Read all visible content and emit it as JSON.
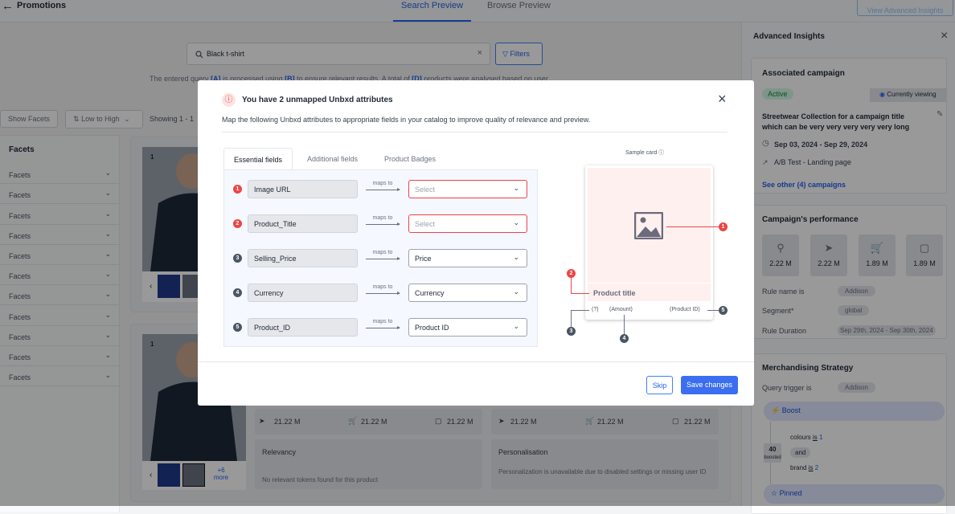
{
  "header": {
    "back_icon": "arrow-left-icon",
    "title": "Promotions",
    "tabs": [
      "Search Preview",
      "Browse Preview"
    ],
    "active_tab": "Search Preview",
    "advanced_button": "View Advanced Insights"
  },
  "search": {
    "value": "Black t-shirt",
    "filters_label": "Filters"
  },
  "info_text": {
    "prefix": "The entered query",
    "a": "[A]",
    "mid1": "is processed using",
    "b": "[B]",
    "mid2": "to ensure relevant results. A total of",
    "d": "[D]",
    "suffix": "products were analysed based on user"
  },
  "toolbar": {
    "show_facets": "Show Facets",
    "sort": "Low to High",
    "showing": "Showing 1 - 1"
  },
  "facets": {
    "title": "Facets",
    "items": [
      "Facets",
      "Facets",
      "Facets",
      "Facets",
      "Facets",
      "Facets",
      "Facets",
      "Facets",
      "Facets",
      "Facets",
      "Facets"
    ]
  },
  "products": [
    {
      "rank": "1"
    },
    {
      "rank": "1",
      "more": "+6",
      "more2": "more",
      "metrics": [
        "21.22 M",
        "21.22 M",
        "21.22 M",
        "21.22 M",
        "21.22 M",
        "21.22 M"
      ],
      "relevancy_title": "Relevancy",
      "relevancy_text": "No relevant tokens found for this product",
      "personal_title": "Personalisation",
      "personal_text": "Personalization is unavailable due to disabled settings or missing user ID"
    }
  ],
  "insights": {
    "title": "Advanced Insights",
    "associated": {
      "title": "Associated campaign",
      "status": "Active",
      "viewing": "Currently viewing",
      "name": "Streetwear Collection for a campaign title which can be very very very very very long",
      "dates": "Sep 03, 2024 - Sep 29, 2024",
      "test": "A/B Test - Landing page",
      "link": "See other (4) campaigns"
    },
    "performance": {
      "title": "Campaign's performance",
      "metrics": [
        "2.22 M",
        "2.22 M",
        "1.89 M",
        "1.89 M"
      ],
      "rule_label": "Rule name is",
      "rule": "Addison",
      "segment_label": "Segment*",
      "segment": "global",
      "duration_label": "Rule Duration",
      "duration": "Sep 29th, 2024 - Sep 30th, 2024"
    },
    "strategy": {
      "title": "Merchandising Strategy",
      "trigger_label": "Query trigger is",
      "trigger": "Addison",
      "boost": "Boost",
      "boost_count": "40",
      "boost_sub": "boosted",
      "c1": "colours",
      "is1": "is",
      "v1": "1",
      "and": "and",
      "c2": "brand",
      "is2": "is",
      "v2": "2",
      "pinned": "Pinned"
    }
  },
  "modal": {
    "title": "You have 2 unmapped Unbxd attributes",
    "description": "Map the following Unbxd attributes to appropriate fields in your catalog to improve quality of relevance and preview.",
    "tabs": [
      "Essential fields",
      "Additional fields",
      "Product Badges"
    ],
    "maps_to": "maps to",
    "rows": [
      {
        "n": "1",
        "field": "Image URL",
        "value": "Select"
      },
      {
        "n": "2",
        "field": "Product_Title",
        "value": "Select"
      },
      {
        "n": "3",
        "field": "Selling_Price",
        "value": "Price"
      },
      {
        "n": "4",
        "field": "Currency",
        "value": "Currency"
      },
      {
        "n": "5",
        "field": "Product_ID",
        "value": "Product ID"
      }
    ],
    "sample": {
      "label": "Sample card",
      "product_title": "Product title",
      "currency": "(?)",
      "amount": "(Amount)",
      "pid": "(Product ID)",
      "n1": "1",
      "n2": "2",
      "n3": "3",
      "n4": "4",
      "n5": "5"
    },
    "skip": "Skip",
    "save": "Save changes"
  },
  "colors": {
    "accent": "#2563eb",
    "error": "#ef4444",
    "active_green": "#15803d"
  }
}
